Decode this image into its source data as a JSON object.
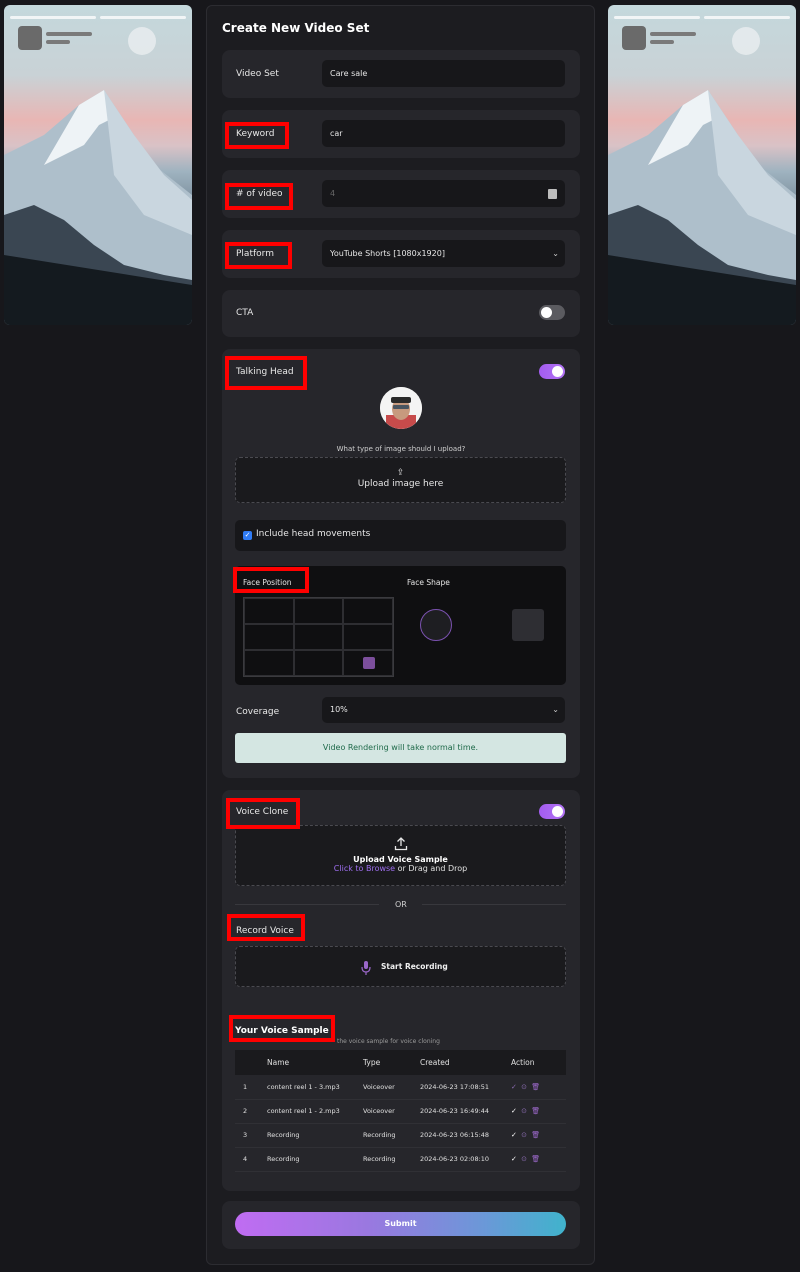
{
  "page": {
    "title": "Create New Video Set"
  },
  "form": {
    "video_set": {
      "label": "Video Set",
      "value": "Care sale"
    },
    "keyword": {
      "label": "Keyword",
      "value": "car"
    },
    "num_videos": {
      "label": "# of video",
      "value": "4"
    },
    "platform": {
      "label": "Platform",
      "value": "YouTube Shorts [1080x1920]"
    },
    "cta": {
      "label": "CTA",
      "enabled": false
    }
  },
  "talking_head": {
    "label": "Talking Head",
    "enabled": true,
    "upload_hint": "What type of image should I upload?",
    "upload_label": "Upload image here",
    "include_head_movements": {
      "label": "Include head movements",
      "checked": true
    },
    "face_position_label": "Face Position",
    "face_shape_label": "Face Shape",
    "coverage": {
      "label": "Coverage",
      "value": "10%"
    },
    "notice": "Video Rendering will take normal time."
  },
  "voice_clone": {
    "label": "Voice Clone",
    "enabled": true,
    "upload_title": "Upload Voice Sample",
    "browse_link": "Click to Browse",
    "drag_text": " or Drag and Drop",
    "or_text": "OR",
    "record_label": "Record Voice",
    "start_recording": "Start Recording"
  },
  "voice_samples": {
    "title": "Your Voice Sample",
    "subtitle": "the voice sample for voice cloning",
    "columns": [
      "",
      "Name",
      "Type",
      "Created",
      "Action"
    ],
    "rows": [
      {
        "num": "1",
        "name": "content reel 1 - 3.mp3",
        "type": "Voiceover",
        "created": "2024-06-23 17:08:51",
        "selected": false
      },
      {
        "num": "2",
        "name": "content reel 1 - 2.mp3",
        "type": "Voiceover",
        "created": "2024-06-23 16:49:44",
        "selected": true
      },
      {
        "num": "3",
        "name": "Recording",
        "type": "Recording",
        "created": "2024-06-23 06:15:48",
        "selected": true
      },
      {
        "num": "4",
        "name": "Recording",
        "type": "Recording",
        "created": "2024-06-23 02:08:10",
        "selected": true
      }
    ]
  },
  "submit_label": "Submit",
  "colors": {
    "accent": "#a35cf0",
    "highlight": "#ff0000",
    "notice_bg": "#d4e6e2"
  },
  "icons": [
    "upload-icon",
    "upload-cloud-icon",
    "microphone-icon",
    "check-icon",
    "download-icon",
    "trash-icon",
    "chevron-down-icon",
    "stepper-icon"
  ]
}
